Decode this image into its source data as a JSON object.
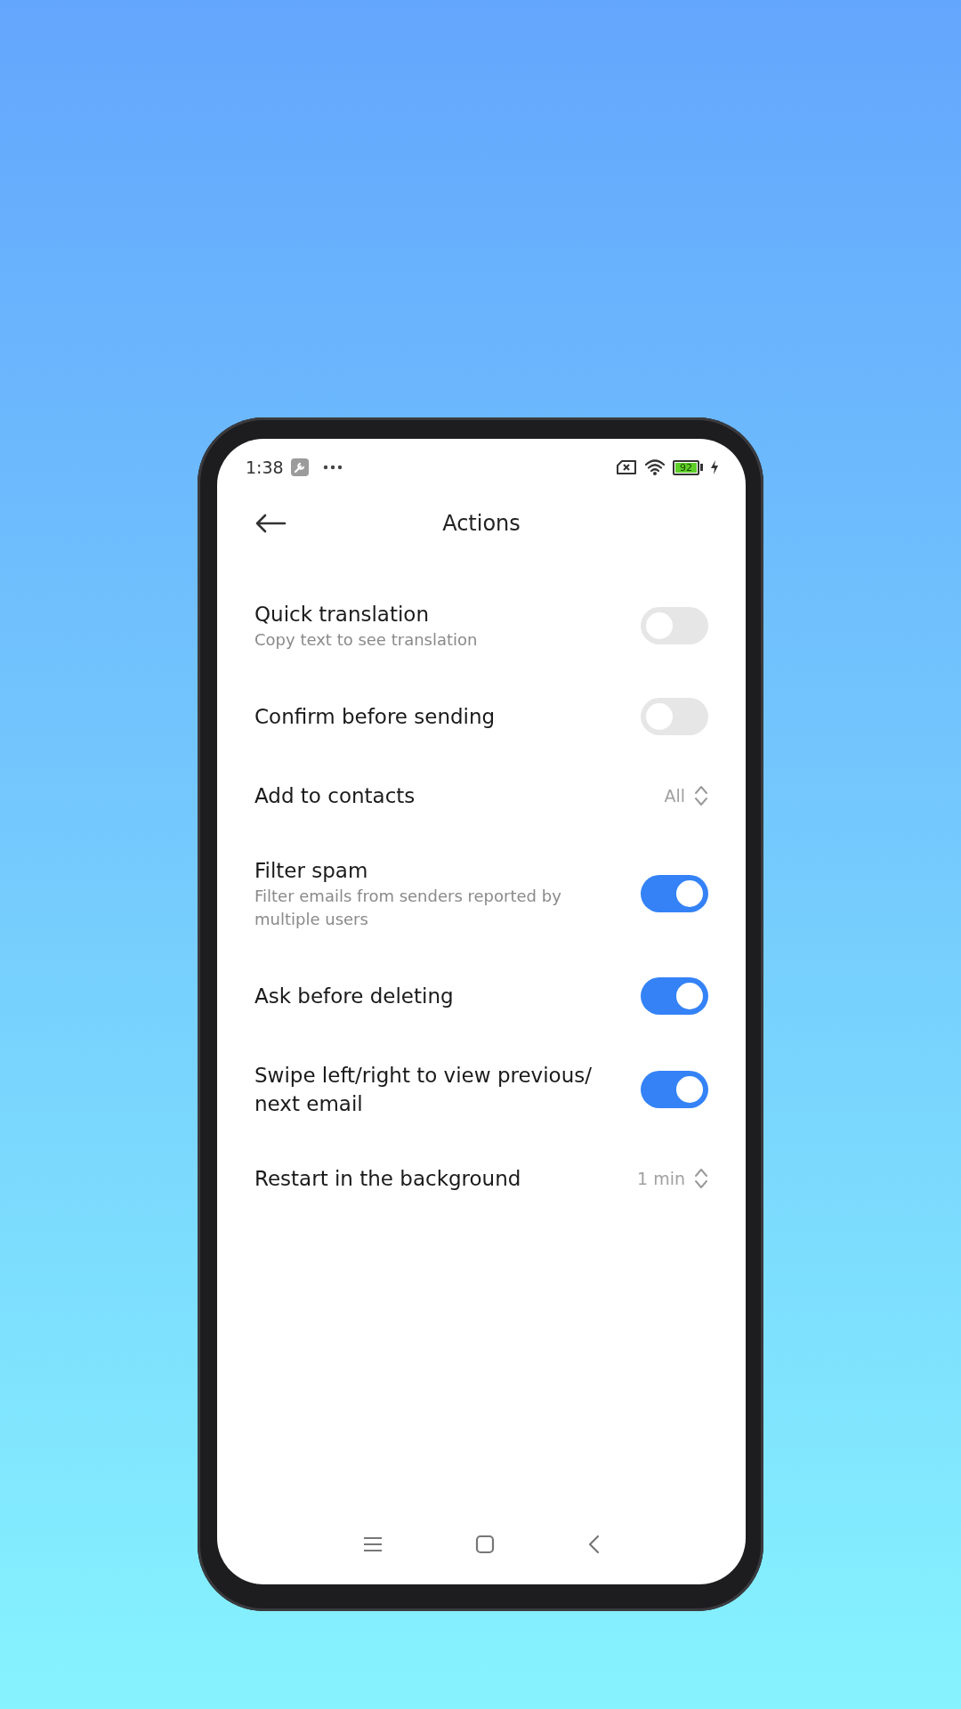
{
  "status_bar": {
    "time": "1:38",
    "battery": "92"
  },
  "header": {
    "title": "Actions"
  },
  "settings": [
    {
      "kind": "toggle",
      "title": "Quick translation",
      "subtitle": "Copy text to see translation",
      "on": false
    },
    {
      "kind": "toggle",
      "title": "Confirm before sending",
      "on": false
    },
    {
      "kind": "select",
      "title": "Add to contacts",
      "value": "All"
    },
    {
      "kind": "toggle",
      "title": "Filter spam",
      "subtitle": "Filter emails from senders reported by multiple users",
      "on": true
    },
    {
      "kind": "toggle",
      "title": "Ask before deleting",
      "on": true
    },
    {
      "kind": "toggle",
      "title": "Swipe left/right to view previous/ next email",
      "on": true
    },
    {
      "kind": "select",
      "title": "Restart in the background",
      "value": "1 min"
    }
  ]
}
